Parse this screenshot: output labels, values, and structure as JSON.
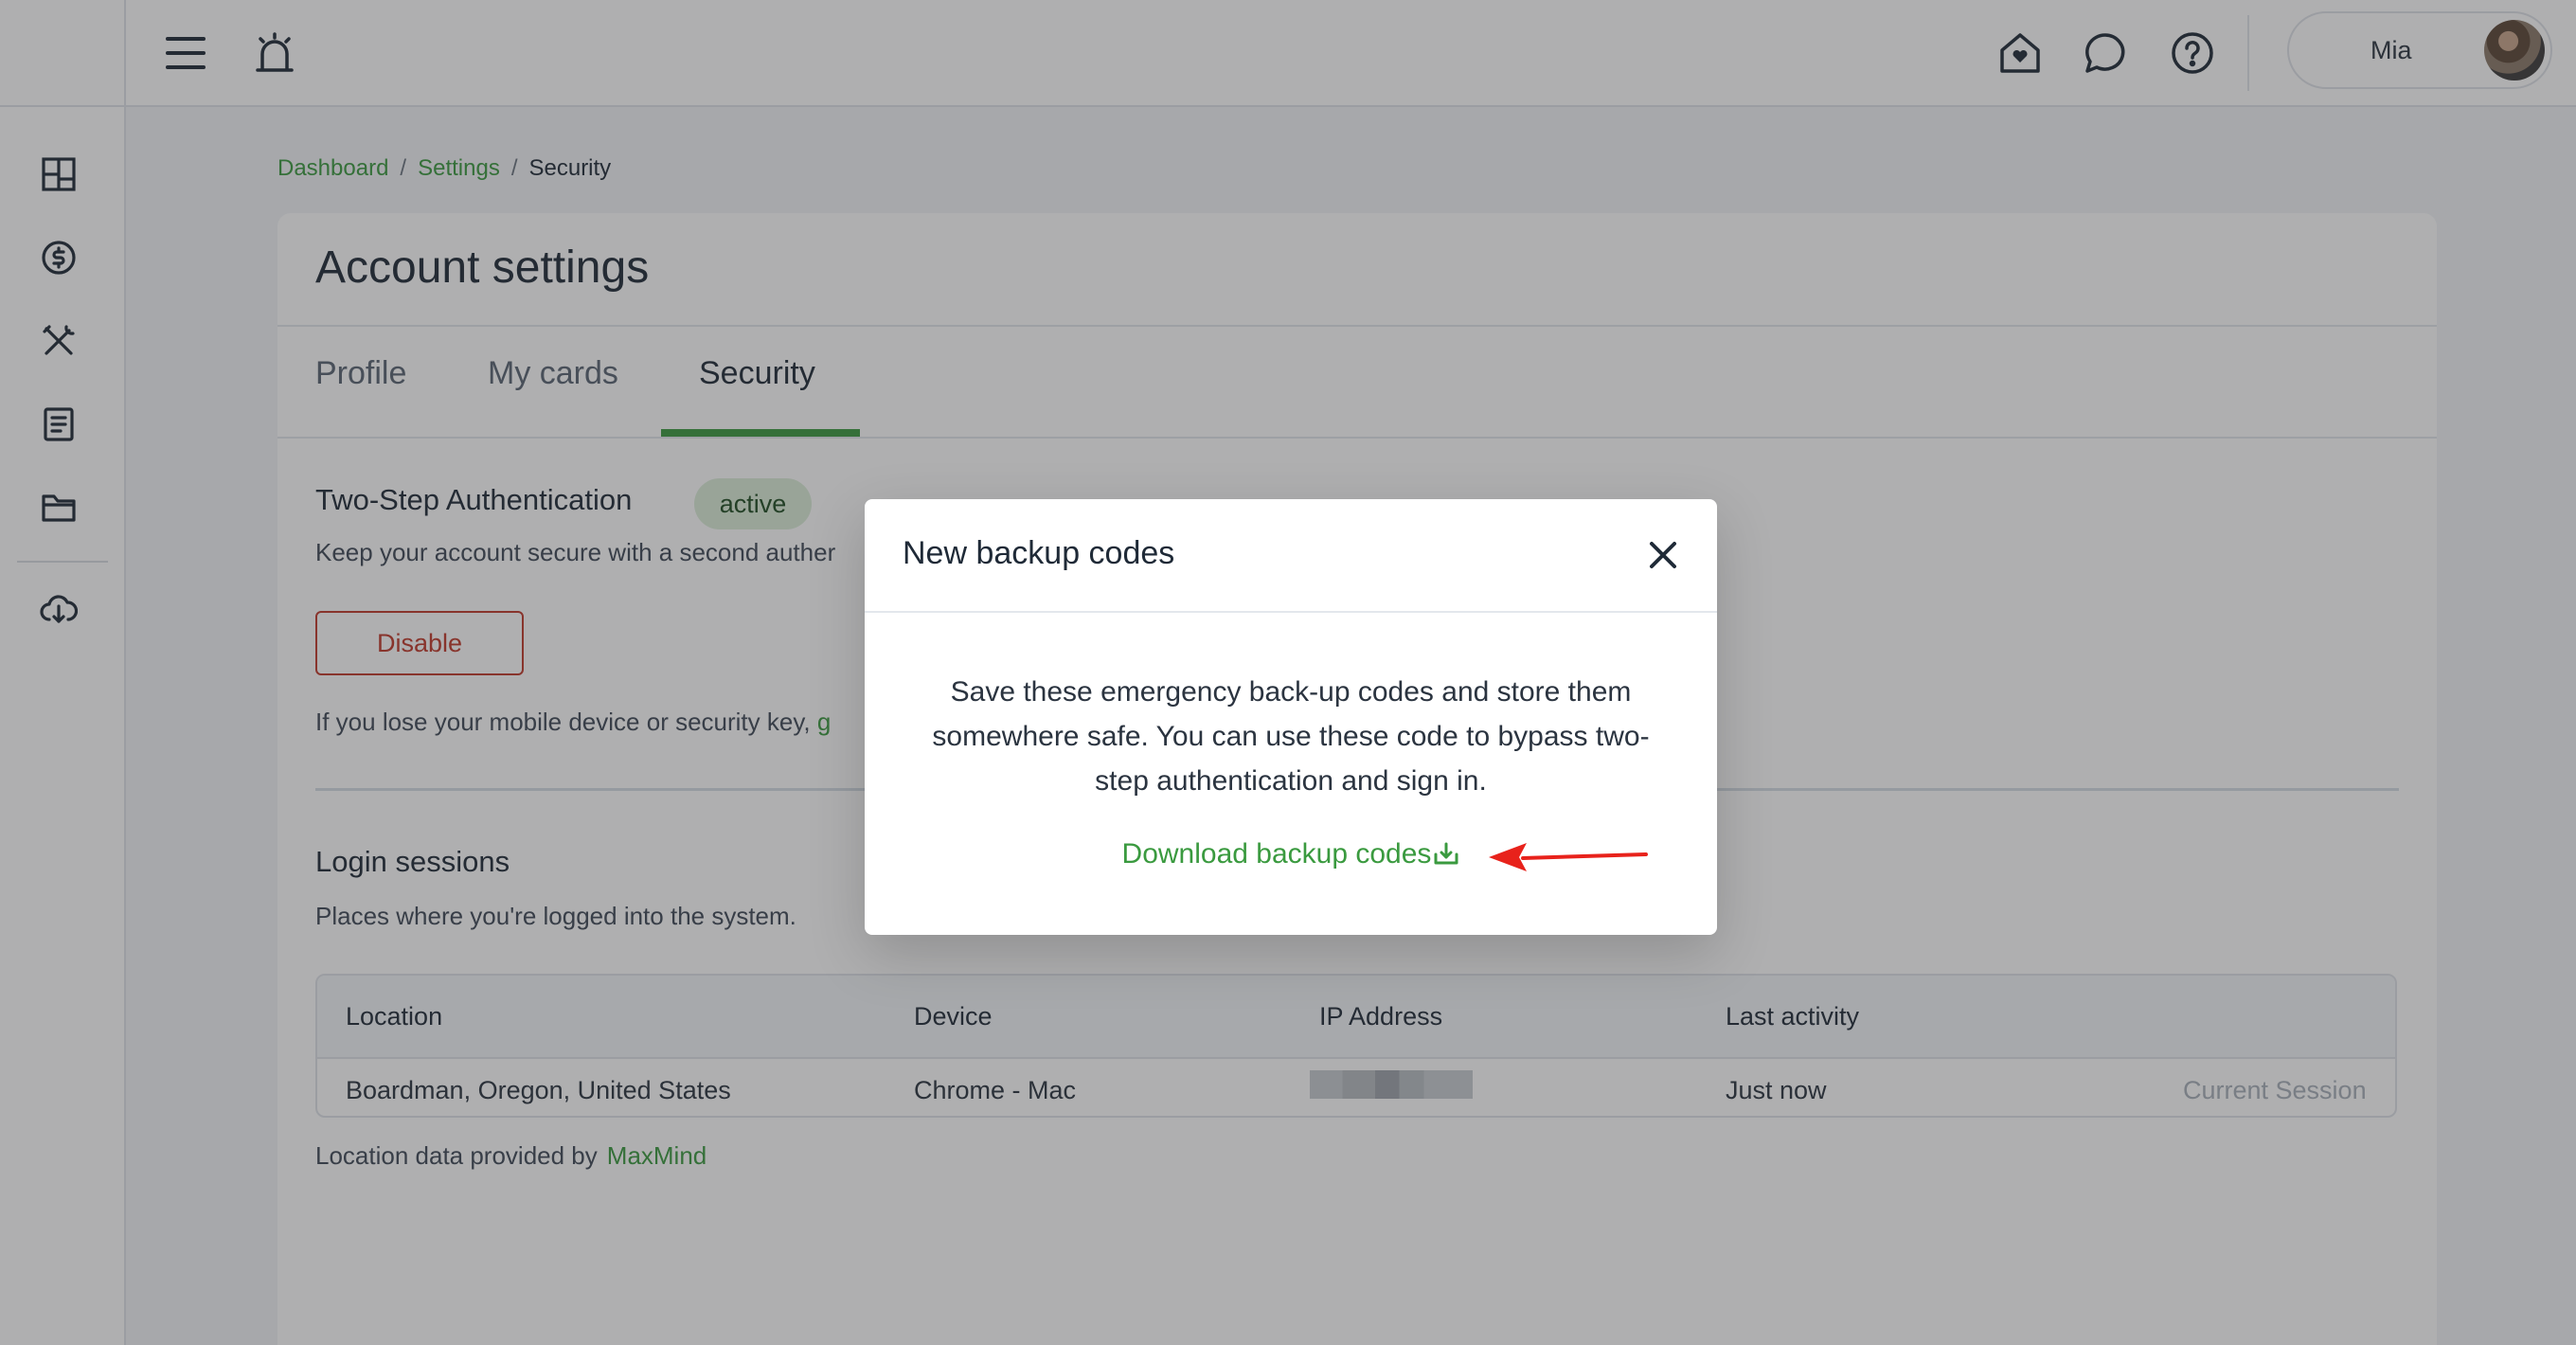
{
  "topbar": {
    "menu_icon": "hamburger-menu-icon",
    "alarm_icon": "alarm-bell-icon",
    "home_icon": "home-heart-icon",
    "chat_icon": "chat-bubble-icon",
    "help_icon": "help-circle-icon",
    "user_name": "Mia"
  },
  "sidebar": {
    "items": [
      {
        "icon": "dashboard-grid-icon"
      },
      {
        "icon": "dollar-circle-icon"
      },
      {
        "icon": "tools-icon"
      },
      {
        "icon": "document-list-icon"
      },
      {
        "icon": "folder-icon"
      },
      {
        "icon": "cloud-download-icon"
      }
    ]
  },
  "breadcrumb": {
    "items": [
      "Dashboard",
      "Settings"
    ],
    "separator": "/",
    "current": "Security"
  },
  "page": {
    "title": "Account settings",
    "tabs": [
      {
        "label": "Profile"
      },
      {
        "label": "My cards"
      },
      {
        "label": "Security"
      }
    ],
    "active_tab": "Security"
  },
  "two_step": {
    "title": "Two-Step Authentication",
    "badge": "active",
    "description": "Keep your account secure with a second auther",
    "disable_label": "Disable",
    "lose_text": "If you lose your mobile device or security key,",
    "lose_link_fragment": "g"
  },
  "login_sessions": {
    "title": "Login sessions",
    "description": "Places where you're logged into the system.",
    "columns": [
      "Location",
      "Device",
      "IP Address",
      "Last activity"
    ],
    "rows": [
      {
        "location": "Boardman, Oregon, United States",
        "device": "Chrome - Mac",
        "ip": "",
        "last_activity": "Just now",
        "status": "Current Session"
      }
    ],
    "provider_text": "Location data provided by",
    "provider_link": "MaxMind"
  },
  "modal": {
    "title": "New backup codes",
    "body": "Save these emergency back-up codes and store them somewhere safe. You can use these code to bypass two-step authentication and sign in.",
    "download_label": "Download backup codes",
    "close_icon": "close-icon",
    "download_icon": "download-icon"
  },
  "colors": {
    "accent": "#3a9a3f",
    "danger": "#c0392b",
    "arrow": "#e8221b"
  }
}
